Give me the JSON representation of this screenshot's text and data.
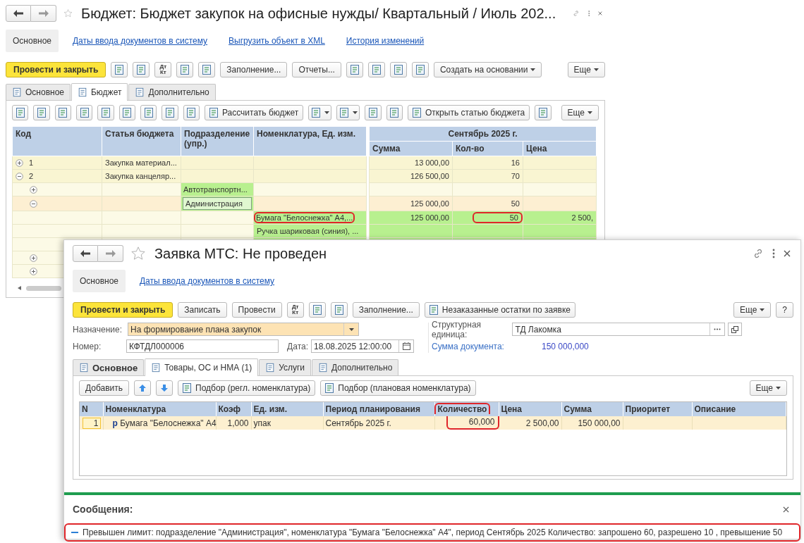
{
  "budget_window": {
    "title": "Бюджет: Бюджет закупок на офисные нужды/ Квартальный / Июль 202...",
    "nav": [
      {
        "label": "Основное",
        "selected": true
      },
      {
        "label": "Даты ввода документов в систему",
        "selected": false
      },
      {
        "label": "Выгрузить объект в XML",
        "selected": false
      },
      {
        "label": "История изменений",
        "selected": false
      }
    ],
    "toolbar": [
      {
        "kind": "primary",
        "label": "Провести и закрыть"
      },
      {
        "kind": "icon"
      },
      {
        "kind": "icon"
      },
      {
        "kind": "dtkt",
        "top": "Дт",
        "bottom": "Кт"
      },
      {
        "kind": "icon"
      },
      {
        "kind": "icon"
      },
      {
        "kind": "text",
        "label": "Заполнение..."
      },
      {
        "kind": "text",
        "label": "Отчеты..."
      },
      {
        "kind": "icon"
      },
      {
        "kind": "icon"
      },
      {
        "kind": "icon"
      },
      {
        "kind": "icon"
      },
      {
        "kind": "menu",
        "label": "Создать на основании"
      },
      {
        "kind": "spacer"
      },
      {
        "kind": "menu",
        "label": "Еще"
      }
    ],
    "tabs": [
      {
        "label": "Основное",
        "selected": false
      },
      {
        "label": "Бюджет",
        "selected": true
      },
      {
        "label": "Дополнительно",
        "selected": false
      }
    ],
    "table_toolbar": [
      {
        "kind": "icon"
      },
      {
        "kind": "icon"
      },
      {
        "kind": "icon"
      },
      {
        "kind": "icon"
      },
      {
        "kind": "icon"
      },
      {
        "kind": "icon"
      },
      {
        "kind": "icon"
      },
      {
        "kind": "icon"
      },
      {
        "kind": "icon"
      },
      {
        "kind": "icon_text",
        "label": "Рассчитать бюджет"
      },
      {
        "kind": "icon_menu"
      },
      {
        "kind": "icon_menu"
      },
      {
        "kind": "icon"
      },
      {
        "kind": "icon"
      },
      {
        "kind": "icon_text",
        "label": "Открыть статью бюджета"
      },
      {
        "kind": "icon"
      },
      {
        "kind": "spacer"
      },
      {
        "kind": "menu",
        "label": "Еще"
      }
    ],
    "table": {
      "columns": [
        "Код",
        "Статья бюджета",
        "Подразделение (упр.)",
        "Номенклатура, Ед. изм."
      ],
      "period": "Сентябрь 2025 г.",
      "period_columns": [
        "Сумма",
        "Кол-во",
        "Цена"
      ],
      "rows": [
        {
          "kind": "article",
          "code": "1",
          "article": "Закупка материал...",
          "sum": "13 000,00",
          "qty": "16",
          "expanded": false
        },
        {
          "kind": "article",
          "code": "2",
          "article": "Закупка канцеляр...",
          "sum": "126 500,00",
          "qty": "70",
          "expanded": true,
          "children": [
            {
              "kind": "department",
              "dept": "Автотранспортн...",
              "expanded": false
            },
            {
              "kind": "department",
              "dept": "Администрация",
              "sum": "125 000,00",
              "qty": "50",
              "expanded": true,
              "focused": true,
              "children": [
                {
                  "kind": "item",
                  "item": "Бумага \"Белоснежка\" А4,...",
                  "sum": "125 000,00",
                  "qty": "50",
                  "price": "2 500,",
                  "item_marked": true,
                  "qty_marked": true
                },
                {
                  "kind": "item",
                  "item": "Ручка шариковая (синия), ..."
                },
                {
                  "kind": "item"
                }
              ]
            },
            {
              "kind": "department",
              "expanded": false
            },
            {
              "kind": "department",
              "expanded": false
            }
          ]
        }
      ]
    }
  },
  "request_window": {
    "title": "Заявка МТС: Не проведен",
    "nav": [
      {
        "label": "Основное",
        "selected": true
      },
      {
        "label": "Даты ввода документов в систему",
        "selected": false
      }
    ],
    "toolbar": [
      {
        "kind": "primary",
        "label": "Провести и закрыть"
      },
      {
        "kind": "text",
        "label": "Записать"
      },
      {
        "kind": "text",
        "label": "Провести"
      },
      {
        "kind": "dtkt",
        "top": "Дт",
        "bottom": "Кт"
      },
      {
        "kind": "icon"
      },
      {
        "kind": "icon"
      },
      {
        "kind": "text",
        "label": "Заполнение..."
      },
      {
        "kind": "icon_text",
        "label": "Незаказанные остатки по заявке"
      },
      {
        "kind": "spacer"
      },
      {
        "kind": "menu",
        "label": "Еще"
      },
      {
        "kind": "text",
        "label": "?"
      }
    ],
    "fields": {
      "purpose": {
        "label": "Назначение:",
        "value": "На формирование плана закупок"
      },
      "number": {
        "label": "Номер:",
        "value": "КФТДЛ000006"
      },
      "date": {
        "label": "Дата:",
        "value": "18.08.2025 12:00:00"
      },
      "unit": {
        "label": "Структурная единица:",
        "value": "ТД Лакомка"
      },
      "total": {
        "label": "Сумма документа:",
        "value": "150 000,000"
      }
    },
    "tabs": [
      {
        "label": "Основное",
        "selected": false,
        "bold": true
      },
      {
        "label": "Товары, ОС и НМА (1)",
        "selected": true,
        "bold": false
      },
      {
        "label": "Услуги",
        "selected": false,
        "bold": false
      },
      {
        "label": "Дополнительно",
        "selected": false,
        "bold": false
      }
    ],
    "table_toolbar": [
      {
        "kind": "text",
        "label": "Добавить"
      },
      {
        "kind": "up"
      },
      {
        "kind": "down"
      },
      {
        "kind": "icon_text",
        "label": "Подбор (регл. номенклатура)"
      },
      {
        "kind": "icon_text",
        "label": "Подбор (плановая номенклатура)"
      },
      {
        "kind": "spacer"
      },
      {
        "kind": "menu",
        "label": "Еще"
      }
    ],
    "table": {
      "columns": [
        {
          "label": "N",
          "marked": false
        },
        {
          "label": "Номенклатура",
          "marked": false
        },
        {
          "label": "Коэф",
          "marked": false
        },
        {
          "label": "Ед. изм.",
          "marked": false
        },
        {
          "label": "Период планирования",
          "marked": false
        },
        {
          "label": "Количество",
          "marked": true
        },
        {
          "label": "Цена",
          "marked": false
        },
        {
          "label": "Сумма",
          "marked": false
        },
        {
          "label": "Приоритет",
          "marked": false
        },
        {
          "label": "Описание",
          "marked": false
        }
      ],
      "rows": [
        {
          "n": "1",
          "type_mark": "р",
          "item": "Бумага \"Белоснежка\" А4",
          "coef": "1,000",
          "unit": "упак",
          "period": "Сентябрь 2025 г.",
          "qty": "60,000",
          "price": "2 500,00",
          "sum": "150 000,00",
          "selected": true
        }
      ]
    },
    "messages": {
      "title": "Сообщения:",
      "items": [
        {
          "text": "Превышен лимит: подразделение \"Администрация\", номенклатура \"Бумага \"Белоснежка\" А4\", период Сентябрь 2025 Количество: запрошено 60, разрешено 10 , превышение 50",
          "marked": true
        }
      ]
    }
  }
}
